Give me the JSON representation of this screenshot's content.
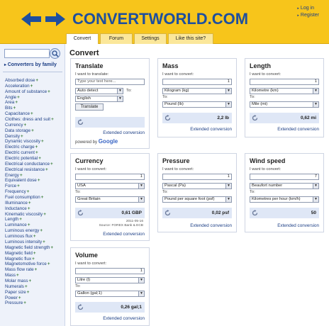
{
  "brand": {
    "name": "CONVERTWORLD.COM"
  },
  "auth": {
    "login": "Log in",
    "register": "Register"
  },
  "tabs": [
    "Convert",
    "Forum",
    "Settings",
    "Like this site?"
  ],
  "sidebar": {
    "heading": "Converters by family",
    "items": [
      "Absorbed dose",
      "Acceleration",
      "Amount of substance",
      "Angle",
      "Area",
      "Bits",
      "Capacitance",
      "Clothes: dress and suit",
      "Currency",
      "Data storage",
      "Density",
      "Dynamic viscosity",
      "Electric charge",
      "Electric current",
      "Electric potential",
      "Electrical conductance",
      "Electrical resistance",
      "Energy",
      "Equivalent dose",
      "Force",
      "Frequency",
      "Fuel consumption",
      "Illuminance",
      "Inductance",
      "Kinematic viscosity",
      "Length",
      "Luminance",
      "Luminous energy",
      "Luminous flux",
      "Luminous intensity",
      "Magnetic field strength",
      "Magnetic field",
      "Magnetic flux",
      "Magnetomotive force",
      "Mass flow rate",
      "Mass",
      "Molar mass",
      "Numerals",
      "Paper size",
      "Power",
      "Pressure"
    ]
  },
  "page_title": "Convert",
  "translate": {
    "title": "Translate",
    "prompt": "I want to translate:",
    "placeholder": "Type your text here...",
    "from": "Auto detect",
    "to_label": "To:",
    "to": "English",
    "button": "Translate",
    "extended": "Extended conversion",
    "powered": "powered by",
    "google": "Google"
  },
  "panels": {
    "mass": {
      "title": "Mass",
      "prompt": "I want to convert:",
      "amount": "1",
      "from": "Kilogram (kg)",
      "to_label": "To:",
      "to": "Pound (lb)",
      "result": "2,2 lb",
      "extended": "Extended conversion"
    },
    "length": {
      "title": "Length",
      "prompt": "I want to convert:",
      "amount": "1",
      "from": "Kilometre (km)",
      "to_label": "To:",
      "to": "Mile (mi)",
      "result": "0,62 mi",
      "extended": "Extended conversion"
    },
    "currency": {
      "title": "Currency",
      "prompt": "I want to convert:",
      "amount": "1",
      "from": "USA",
      "to_label": "To:",
      "to": "Great Britain",
      "result": "0,61 GBP",
      "source_date": "2011-05-16",
      "source": "Source: FOREX Bank & ECB",
      "extended": "Extended conversion"
    },
    "pressure": {
      "title": "Pressure",
      "prompt": "I want to convert:",
      "amount": "1",
      "from": "Pascal (Pa)",
      "to_label": "To:",
      "to": "Pound per square foot (psf)",
      "result": "0,02 psf",
      "extended": "Extended conversion"
    },
    "wind": {
      "title": "Wind speed",
      "prompt": "I want to convert:",
      "amount": "7",
      "from": "Beaufort number",
      "to_label": "To:",
      "to": "Kilometres per hour (km/h)",
      "result": "50",
      "extended": "Extended conversion"
    },
    "volume": {
      "title": "Volume",
      "prompt": "I want to convert:",
      "amount": "1",
      "from": "Litre (l)",
      "to_label": "To:",
      "to": "Gallon (gal;1)",
      "result": "0,26 gal;1",
      "extended": "Extended conversion"
    }
  },
  "colors": {
    "header": "#f7c51b",
    "brand_blue": "#1e4f9e",
    "result_bg": "#dfe7f6",
    "sidebar_bg": "#eef2fa"
  }
}
